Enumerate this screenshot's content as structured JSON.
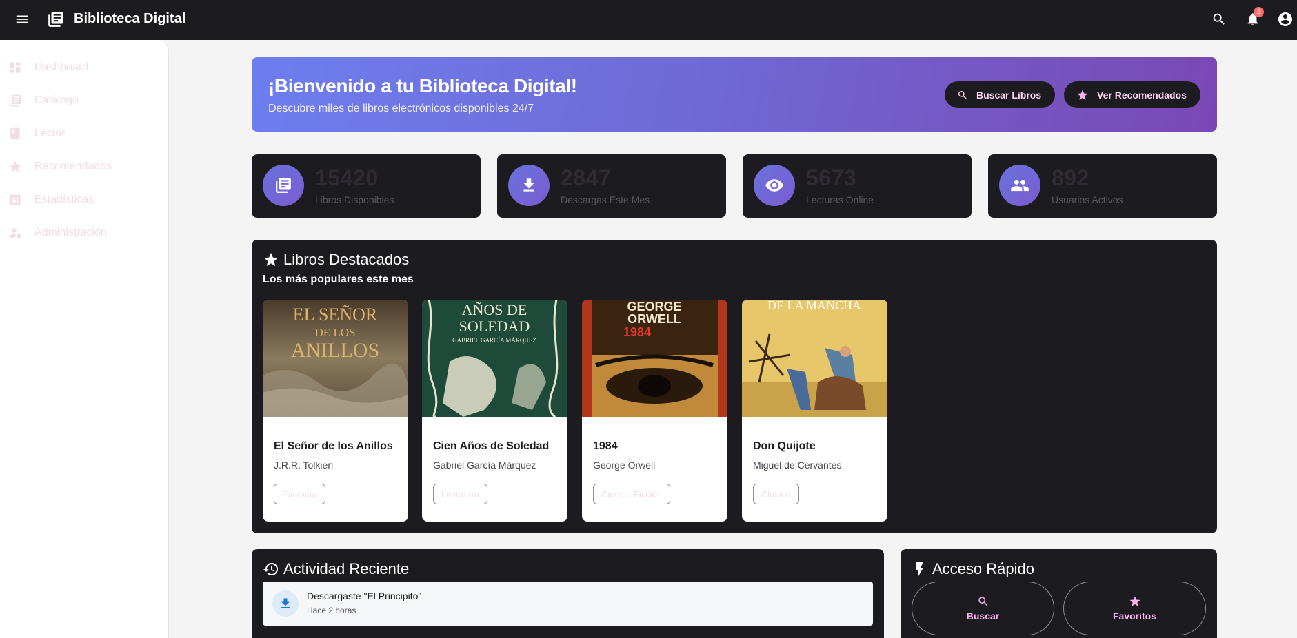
{
  "topbar": {
    "app_title": "Biblioteca Digital",
    "notifications_count": "2",
    "icons": [
      "menu-icon",
      "library-icon",
      "search-icon",
      "bell-icon",
      "account-icon"
    ]
  },
  "sidebar": {
    "items": [
      {
        "label": "Dashboard",
        "icon": "dashboard-icon"
      },
      {
        "label": "Catálogo",
        "icon": "catalog-icon"
      },
      {
        "label": "Lector",
        "icon": "book-icon"
      },
      {
        "label": "Recomendados",
        "icon": "star-icon"
      },
      {
        "label": "Estadísticas",
        "icon": "analytics-icon"
      },
      {
        "label": "Administración",
        "icon": "admin-icon"
      }
    ]
  },
  "hero": {
    "title": "¡Bienvenido a tu Biblioteca Digital!",
    "subtitle": "Descubre miles de libros electrónicos disponibles 24/7",
    "search_button": "Buscar Libros",
    "recommended_button": "Ver Recomendados"
  },
  "stats": [
    {
      "value": "15420",
      "label": "Libros Disponibles",
      "icon": "library-icon"
    },
    {
      "value": "2847",
      "label": "Descargas Este Mes",
      "icon": "download-icon"
    },
    {
      "value": "5673",
      "label": "Lecturas Online",
      "icon": "eye-icon"
    },
    {
      "value": "892",
      "label": "Usuarios Activos",
      "icon": "group-icon"
    }
  ],
  "featured": {
    "title": "Libros Destacados",
    "subtitle": "Los más populares este mes",
    "books": [
      {
        "title": "El Señor de los Anillos",
        "author": "J.R.R. Tolkien",
        "genre": "Fantasía",
        "cover_text": "EL SEÑOR DE LOS ANILLOS"
      },
      {
        "title": "Cien Años de Soledad",
        "author": "Gabriel García Márquez",
        "genre": "Literatura",
        "cover_text": "AÑOS DE SOLEDAD",
        "cover_author": "GABRIEL GARCÍA MÁRQUEZ"
      },
      {
        "title": "1984",
        "author": "George Orwell",
        "genre": "Ciencia Ficción",
        "cover_text": "GEORGE ORWELL",
        "cover_number": "1984"
      },
      {
        "title": "Don Quijote",
        "author": "Miguel de Cervantes",
        "genre": "Clásico",
        "cover_text": "DE LA MANCHA"
      }
    ]
  },
  "activity": {
    "title": "Actividad Reciente",
    "items": [
      {
        "text": "Descargaste \"El Principito\"",
        "time": "Hace 2 horas"
      }
    ]
  },
  "quick_access": {
    "title": "Acceso Rápido",
    "buttons": [
      {
        "label": "Buscar",
        "icon": "search-icon"
      },
      {
        "label": "Favoritos",
        "icon": "star-icon"
      }
    ]
  },
  "colors": {
    "topbar": "#1c1b1f",
    "card_dark": "#1c1b1f",
    "accent_pink": "#ffb2ee",
    "hero_gradient_start": "#6d7ef0",
    "hero_gradient_end": "#7a48b4"
  }
}
